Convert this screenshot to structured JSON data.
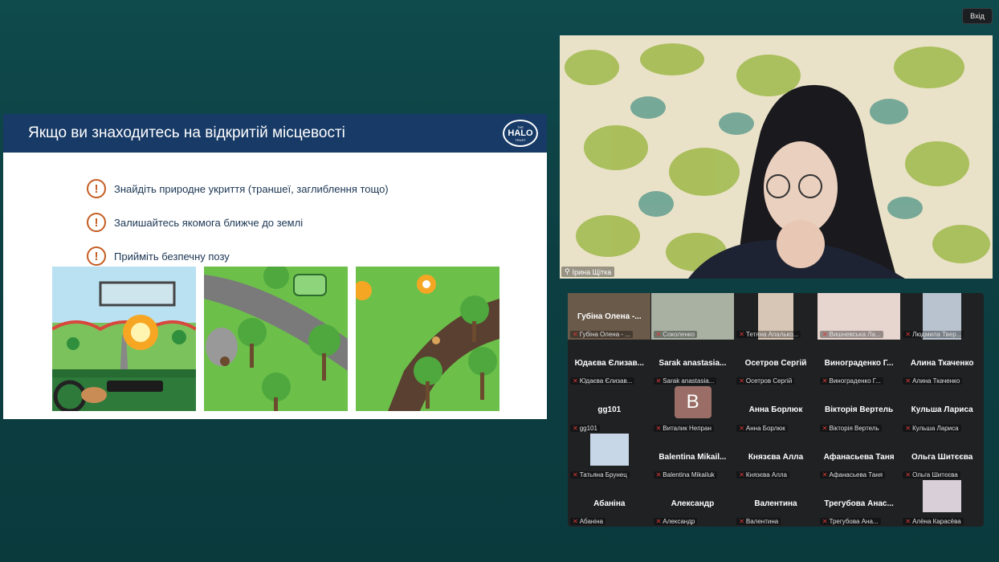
{
  "top_button": "Вхід",
  "slide": {
    "title": "Якщо ви знаходитесь на відкритій місцевості",
    "logo_text": [
      "THE",
      "HALO",
      "TRUST"
    ],
    "warn_icon": "!",
    "bullets": [
      "Знайдіть природне укриття (траншеї, заглиблення тощо)",
      "Залишайтесь якомога ближче до землі",
      "Прийміть безпечну позу"
    ]
  },
  "speaker": {
    "name": "Ірина Щітка"
  },
  "participants": [
    {
      "display": "Губіна Олена -...",
      "label": "Губіна Олена - ..."
    },
    {
      "display": "",
      "label": "Соколенко"
    },
    {
      "display": "",
      "label": "Тетяна Апалько..."
    },
    {
      "display": "",
      "label": "Вишневська Ла..."
    },
    {
      "display": "",
      "label": "Людмила Твер..."
    },
    {
      "display": "Юдаєва Єлизав...",
      "label": "Юдаєва Єлизав..."
    },
    {
      "display": "Sarak anastasia...",
      "label": "Sarak anastasia..."
    },
    {
      "display": "Осетров Сергій",
      "label": "Осетров Сергій"
    },
    {
      "display": "Винограденко Г...",
      "label": "Винограденко Г..."
    },
    {
      "display": "Алина Ткаченко",
      "label": "Алина Ткаченко"
    },
    {
      "display": "gg101",
      "label": "gg101"
    },
    {
      "display": "B",
      "label": "Виталик Непран"
    },
    {
      "display": "Анна Борлюк",
      "label": "Анна Борлюк"
    },
    {
      "display": "Вікторія Вертель",
      "label": "Вікторія Вертель"
    },
    {
      "display": "Кульша Лариса",
      "label": "Кульша Лариса"
    },
    {
      "display": "",
      "label": "Татьяна Брунец"
    },
    {
      "display": "Balentina Mikail...",
      "label": "Balentina Mikailuk"
    },
    {
      "display": "Князєва Алла",
      "label": "Князєва Алла"
    },
    {
      "display": "Афанасьева Таня",
      "label": "Афанасьева Таня"
    },
    {
      "display": "Ольга Шитєєва",
      "label": "Ольга Шитєєва"
    },
    {
      "display": "Абаніна",
      "label": "Абаніна"
    },
    {
      "display": "Александр",
      "label": "Александр"
    },
    {
      "display": "Валентина",
      "label": "Валентина"
    },
    {
      "display": "Трегубова Анас...",
      "label": "Трегубова Ана..."
    },
    {
      "display": "",
      "label": "Алёна Карасёва"
    }
  ],
  "icons": {
    "muted": "mic-off-icon",
    "pin": "pin-icon"
  },
  "colors": {
    "slide_header": "#173a66",
    "accent": "#c45c21",
    "mute": "#e23a3a"
  }
}
